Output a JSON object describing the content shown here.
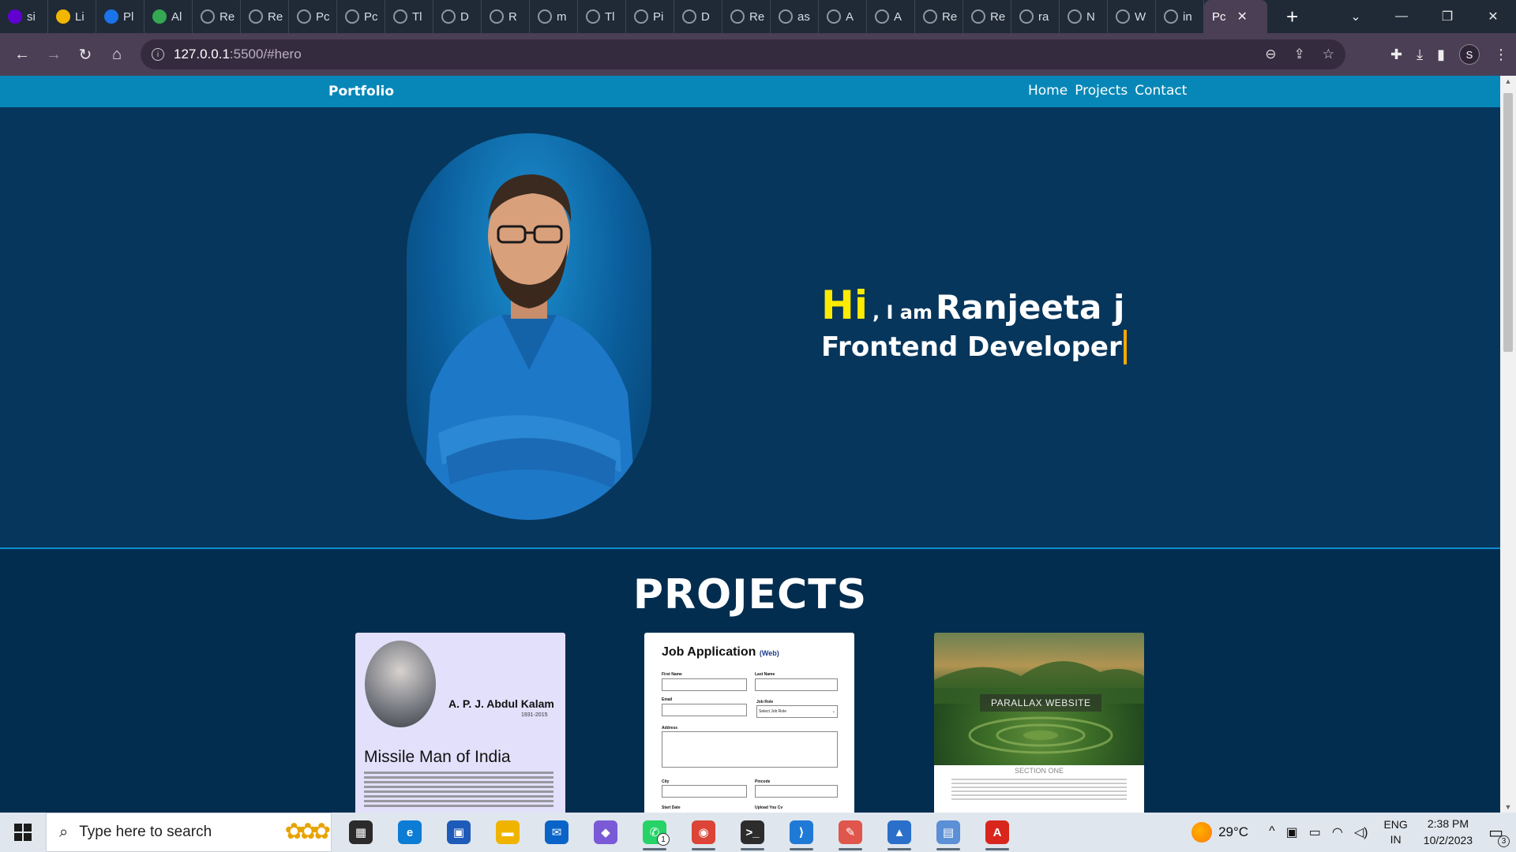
{
  "browser": {
    "tabs": [
      {
        "label": "si",
        "icon": "yahoo-icon",
        "color": "#6001d2"
      },
      {
        "label": "Li",
        "icon": "chart-icon",
        "color": "#f2b600"
      },
      {
        "label": "Pl",
        "icon": "zoho-icon",
        "color": "#1a73e8"
      },
      {
        "label": "Al",
        "icon": "drive-icon",
        "color": "#34a853"
      },
      {
        "label": "Re",
        "icon": "globe-icon"
      },
      {
        "label": "Re",
        "icon": "globe-icon"
      },
      {
        "label": "Pc",
        "icon": "globe-icon"
      },
      {
        "label": "Pc",
        "icon": "globe-icon"
      },
      {
        "label": "Tl",
        "icon": "globe-icon"
      },
      {
        "label": "D",
        "icon": "globe-icon"
      },
      {
        "label": "R",
        "icon": "globe-icon"
      },
      {
        "label": "m",
        "icon": "globe-icon"
      },
      {
        "label": "Tl",
        "icon": "globe-icon"
      },
      {
        "label": "Pi",
        "icon": "globe-icon"
      },
      {
        "label": "D",
        "icon": "globe-icon"
      },
      {
        "label": "Re",
        "icon": "globe-icon"
      },
      {
        "label": "as",
        "icon": "globe-icon"
      },
      {
        "label": "A",
        "icon": "globe-icon"
      },
      {
        "label": "A",
        "icon": "globe-icon"
      },
      {
        "label": "Re",
        "icon": "globe-icon"
      },
      {
        "label": "Re",
        "icon": "globe-icon"
      },
      {
        "label": "ra",
        "icon": "github-icon"
      },
      {
        "label": "N",
        "icon": "globe-icon"
      },
      {
        "label": "W",
        "icon": "globe-icon"
      },
      {
        "label": "in",
        "icon": "globe-icon"
      }
    ],
    "active_tab": {
      "label": "Pc",
      "close": "✕"
    },
    "new_tab": "+",
    "url_host": "127.0.0.1",
    "url_path": ":5500/#hero",
    "profile_initial": "S"
  },
  "site": {
    "brand": "Portfolio",
    "nav": [
      {
        "label": "Home"
      },
      {
        "label": "Projects"
      },
      {
        "label": "Contact"
      }
    ],
    "hero": {
      "hi": "Hi",
      "iam": ", I am",
      "name": "Ranjeeta j",
      "role": "Frontend Developer"
    },
    "projects_heading": "PROJECTS",
    "card1": {
      "name": "A. P. J. Abdul Kalam",
      "years": "1931-2015",
      "title": "Missile Man of India"
    },
    "card2": {
      "title": "Job Application",
      "tag": "(Web)",
      "first_name": "First Name",
      "last_name": "Last Name",
      "email": "Email",
      "job_role": "Job Role",
      "job_role_select": "Select Job Role",
      "address": "Address",
      "city": "City",
      "pincode": "Pincode",
      "start_date": "Start Date",
      "upload": "Upload You Cv"
    },
    "card3": {
      "label": "PARALLAX WEBSITE",
      "section": "SECTION ONE"
    }
  },
  "taskbar": {
    "search_placeholder": "Type here to search",
    "apps": [
      {
        "name": "task-view",
        "color": "#2b2b2b",
        "glyph": "▦"
      },
      {
        "name": "edge",
        "color": "#0c7cd5",
        "glyph": "e"
      },
      {
        "name": "store",
        "color": "#1e5bb8",
        "glyph": "▣"
      },
      {
        "name": "file-explorer",
        "color": "#f0b400",
        "glyph": "▬"
      },
      {
        "name": "mail",
        "color": "#0a64c8",
        "glyph": "✉"
      },
      {
        "name": "copilot",
        "color": "#7a5ad6",
        "glyph": "◆"
      },
      {
        "name": "whatsapp",
        "color": "#25d366",
        "glyph": "✆",
        "badge": "1"
      },
      {
        "name": "chrome",
        "color": "#db4437",
        "glyph": "◉"
      },
      {
        "name": "terminal",
        "color": "#2c2c2c",
        "glyph": ">_"
      },
      {
        "name": "vscode",
        "color": "#1f7ad6",
        "glyph": "⟩"
      },
      {
        "name": "paint",
        "color": "#e0564c",
        "glyph": "✎"
      },
      {
        "name": "photos",
        "color": "#2a6fc9",
        "glyph": "▲"
      },
      {
        "name": "notepad-app",
        "color": "#5b8fd6",
        "glyph": "▤"
      },
      {
        "name": "acrobat",
        "color": "#d8261c",
        "glyph": "A"
      }
    ],
    "temperature": "29°C",
    "lang_top": "ENG",
    "lang_bottom": "IN",
    "time": "2:38 PM",
    "date": "10/2/2023",
    "notifications": "3"
  }
}
